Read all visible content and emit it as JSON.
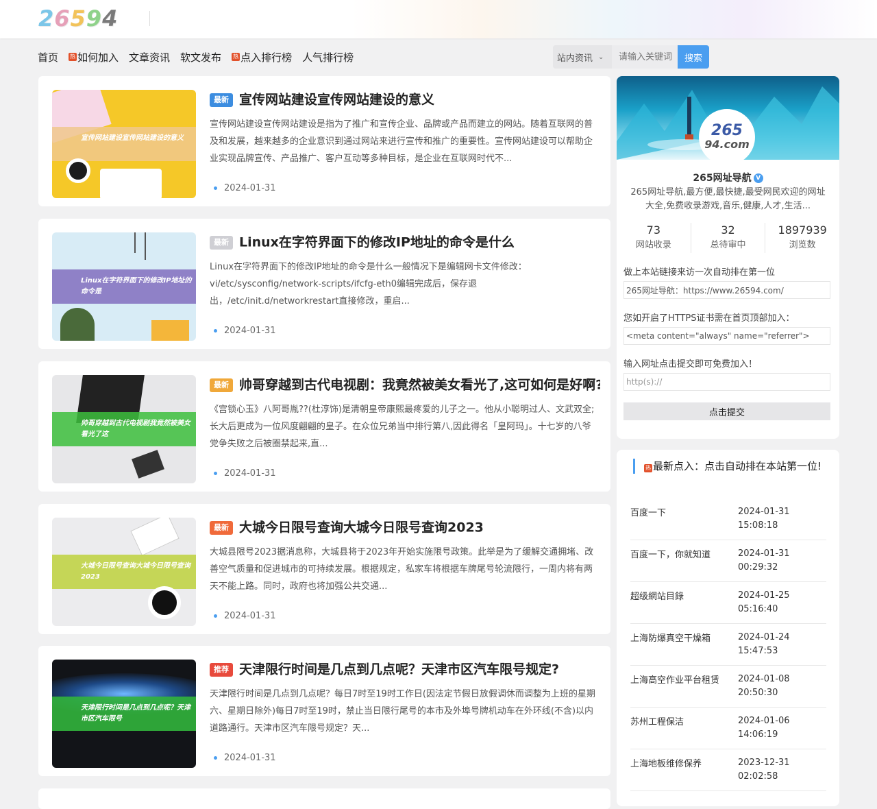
{
  "logo": {
    "text": "26594",
    "letters": [
      "2",
      "6",
      "5",
      "9",
      "4"
    ],
    "colors": [
      "#7cc6e8",
      "#e6a0b8",
      "#f2c35a",
      "#8fd28a",
      "#7a7a7a"
    ]
  },
  "nav": [
    {
      "label": "首页",
      "hot": false
    },
    {
      "label": "如何加入",
      "hot": true
    },
    {
      "label": "文章资讯",
      "hot": false
    },
    {
      "label": "软文发布",
      "hot": false
    },
    {
      "label": "点入排行榜",
      "hot": true
    },
    {
      "label": "人气排行榜",
      "hot": false
    }
  ],
  "hot_badge": "热",
  "search": {
    "scope": "站内资讯",
    "placeholder": "请输入关键词",
    "button": "搜索"
  },
  "articles": [
    {
      "tag": "最新",
      "tag_color": "#3c8de0",
      "title": "宣传网站建设宣传网站建设的意义",
      "desc": "宣传网站建设宣传网站建设是指为了推广和宣传企业、品牌或产品而建立的网站。随着互联网的普及和发展，越来越多的企业意识到通过网站来进行宣传和推广的重要性。宣传网站建设可以帮助企业实现品牌宣传、产品推广、客户互动等多种目标，是企业在互联网时代不...",
      "date": "2024-01-31",
      "thumb_text": "宣传网站建设宣传网站建设的意义",
      "thumb_bg": "#f5c828",
      "band_color": "rgba(240,200,140,0.85)"
    },
    {
      "tag": "最新",
      "tag_color": "#cfcfd4",
      "title": "Linux在字符界面下的修改IP地址的命令是什么",
      "desc": "Linux在字符界面下的修改IP地址的命令是什么一般情况下是编辑网卡文件修改：vi/etc/sysconfig/network-scripts/ifcfg-eth0编辑完成后，保存退出，/etc/init.d/networkrestart直接修改，重启...",
      "date": "2024-01-31",
      "thumb_text": "Linux在字符界面下的修改IP地址的命令是",
      "thumb_bg": "#d8ecf6",
      "band_color": "rgba(130,110,190,0.85)"
    },
    {
      "tag": "最新",
      "tag_color": "#f0a83a",
      "title": "帅哥穿越到古代电视剧：我竟然被美女看光了,这可如何是好啊?",
      "desc": "《宫锁心玉》八阿哥胤??(杜淳饰)是清朝皇帝康熙最疼爱的儿子之一。他从小聪明过人、文武双全;长大后更成为一位风度翩翩的皇子。在众位兄弟当中排行第八,因此得名「皇阿玛」。十七岁的八爷党争失败之后被圈禁起来,直...",
      "date": "2024-01-31",
      "thumb_text": "帅哥穿越到古代电视剧我竟然被美女看光了这",
      "thumb_bg": "#e7e7e9",
      "band_color": "rgba(60,190,60,0.85)"
    },
    {
      "tag": "最新",
      "tag_color": "#f06a3a",
      "title": "大城今日限号查询大城今日限号查询2023",
      "desc": "大城县限号2023据消息称，大城县将于2023年开始实施限号政策。此举是为了缓解交通拥堵、改善空气质量和促进城市的可持续发展。根据规定，私家车将根据车牌尾号轮流限行，一周内将有两天不能上路。同时，政府也将加强公共交通...",
      "date": "2024-01-31",
      "thumb_text": "大城今日限号查询大城今日限号查询2023",
      "thumb_bg": "#ececee",
      "band_color": "rgba(190,210,60,0.85)"
    },
    {
      "tag": "推荐",
      "tag_color": "#e84a3c",
      "title": "天津限行时间是几点到几点呢？天津市区汽车限号规定?",
      "desc": "天津限行时间是几点到几点呢？每日7时至19时工作日(因法定节假日放假调休而调整为上班的星期六、星期日除外)每日7时至19时，禁止当日限行尾号的本市及外埠号牌机动车在外环线(不含)以内道路通行。天津市区汽车限号规定？天...",
      "date": "2024-01-31",
      "thumb_text": "天津限行时间是几点到几点呢？天津市区汽车限号",
      "thumb_bg": "#121418",
      "band_color": "rgba(50,180,60,0.9)"
    }
  ],
  "profile": {
    "avatar_line1": "265",
    "avatar_line2": "94.com",
    "name": "265网址导航",
    "verified": "V",
    "desc": "265网址导航,最方便,最快捷,最受网民欢迎的网址大全,免费收录游戏,音乐,健康,人才,生活...",
    "stats": [
      {
        "value": "73",
        "label": "网站收录"
      },
      {
        "value": "32",
        "label": "总待审中"
      },
      {
        "value": "1897939",
        "label": "浏览数"
      }
    ],
    "link_label": "做上本站链接来访一次自动排在第一位",
    "link_value": "265网址导航：https://www.26594.com/",
    "https_label": "您如开启了HTTPS证书需在首页顶部加入：",
    "https_value": "<meta content=\"always\" name=\"referrer\">",
    "submit_label": "输入网址点击提交即可免费加入！",
    "submit_placeholder": "http(s)://",
    "submit_button": "点击提交"
  },
  "recent": {
    "heading": "最新点入：点击自动排在本站第一位!",
    "items": [
      {
        "name": "百度一下",
        "date": "2024-01-31",
        "time": "15:08:18"
      },
      {
        "name": "百度一下，你就知道",
        "date": "2024-01-31",
        "time": "00:29:32"
      },
      {
        "name": "超级網站目錄",
        "date": "2024-01-25",
        "time": "05:16:40"
      },
      {
        "name": "上海防爆真空干燥箱",
        "date": "2024-01-24",
        "time": "15:47:53"
      },
      {
        "name": "上海高空作业平台租赁",
        "date": "2024-01-08",
        "time": "20:50:30"
      },
      {
        "name": "苏州工程保洁",
        "date": "2024-01-06",
        "time": "14:06:19"
      },
      {
        "name": "上海地板维修保养",
        "date": "2023-12-31",
        "time": "02:02:58"
      }
    ]
  }
}
